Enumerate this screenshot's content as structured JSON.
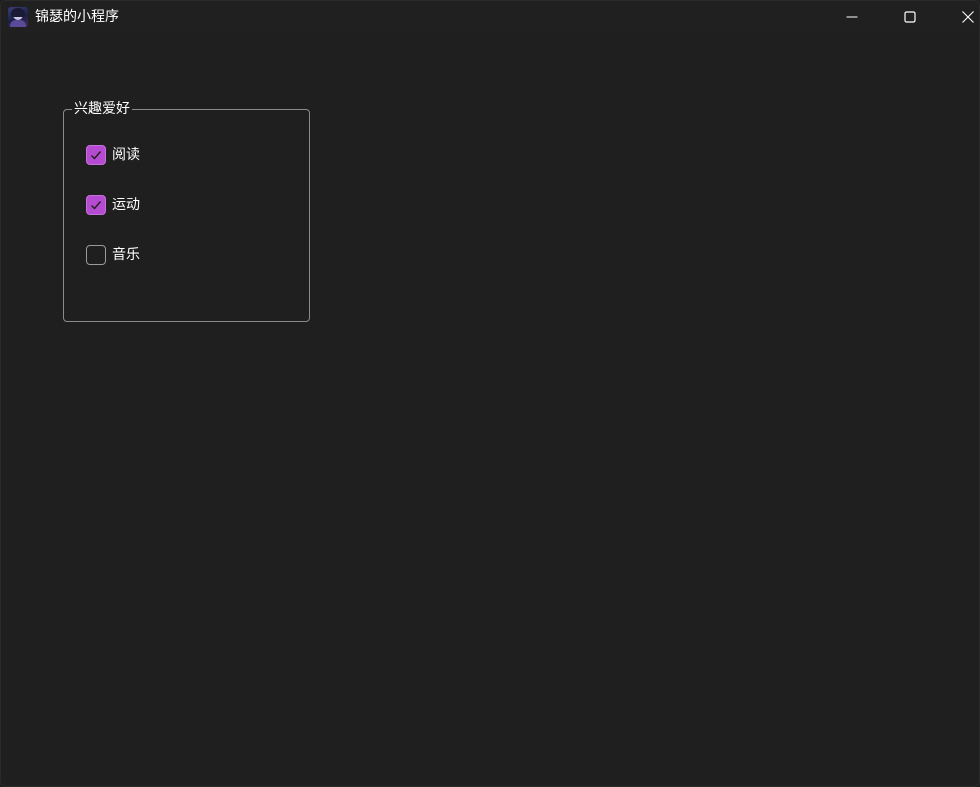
{
  "window": {
    "title": "锦瑟的小程序",
    "icon": "app-avatar-icon",
    "controls": {
      "minimize": "minimize-icon",
      "maximize": "maximize-icon",
      "close": "close-icon"
    }
  },
  "hobbies": {
    "title": "兴趣爱好",
    "items": [
      {
        "label": "阅读",
        "checked": true
      },
      {
        "label": "运动",
        "checked": true
      },
      {
        "label": "音乐",
        "checked": false
      }
    ]
  },
  "colors": {
    "background": "#1f1f1f",
    "accent": "#b44bd1",
    "border": "#8a8a8a",
    "text": "#ffffff"
  }
}
